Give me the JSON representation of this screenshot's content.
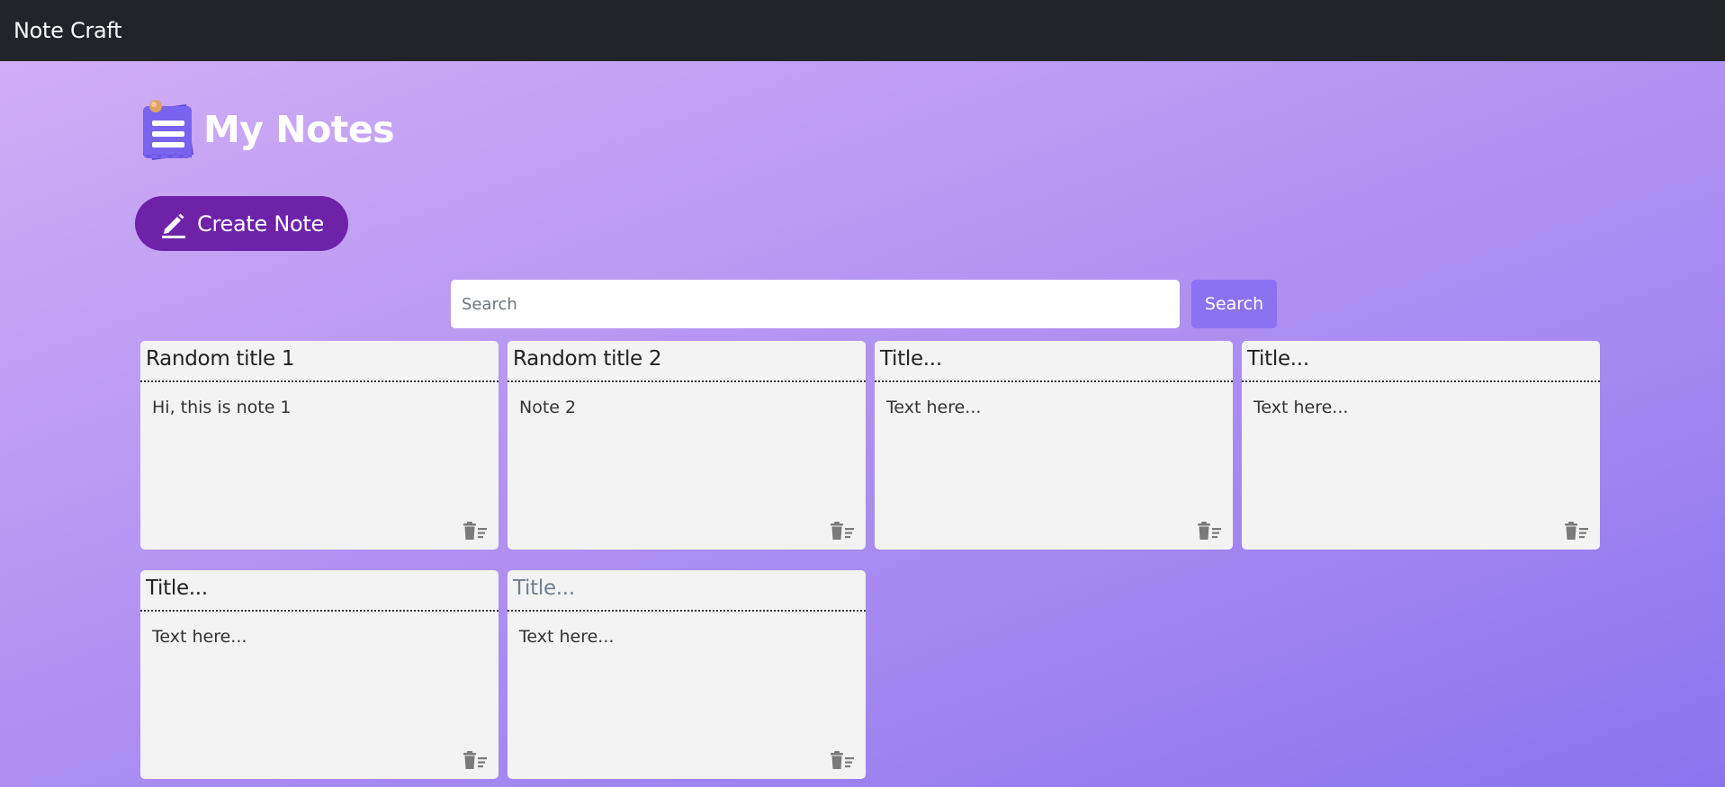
{
  "navbar": {
    "brand": "Note Craft"
  },
  "header": {
    "title": "My Notes",
    "logo_icon": "notepad-icon"
  },
  "actions": {
    "create_label": "Create Note",
    "create_icon": "pencil-icon"
  },
  "search": {
    "placeholder": "Search",
    "value": "",
    "button_label": "Search"
  },
  "notes": [
    {
      "title": "Random title 1",
      "text": "Hi, this is note 1",
      "placeholder_title": false
    },
    {
      "title": "Random title 2",
      "text": "Note 2",
      "placeholder_title": false
    },
    {
      "title": "Title...",
      "text": "Text here...",
      "placeholder_title": false
    },
    {
      "title": "Title...",
      "text": "Text here...",
      "placeholder_title": false
    },
    {
      "title": "Title...",
      "text": "Text here...",
      "placeholder_title": false
    },
    {
      "title": "Title...",
      "text": "Text here...",
      "placeholder_title": true
    }
  ],
  "colors": {
    "navbar": "#212529",
    "create_button": "#6e22a8",
    "search_button": "#8b72f2",
    "card_background": "#f3f3f3"
  }
}
